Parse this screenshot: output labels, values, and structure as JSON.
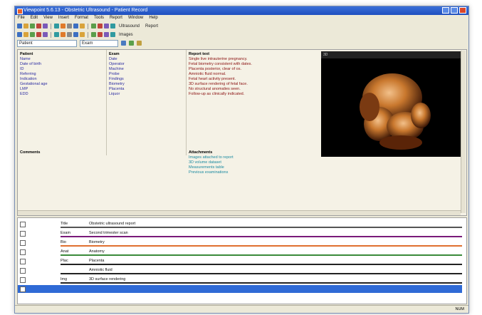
{
  "window": {
    "title": "Viewpoint 5.6.13 - Obstetric Ultrasound - Patient Record",
    "icons": {
      "app": "app-icon",
      "minimize": "minimize-icon",
      "maximize": "maximize-icon",
      "close": "close-icon"
    }
  },
  "menubar": [
    "File",
    "Edit",
    "View",
    "Insert",
    "Format",
    "Tools",
    "Report",
    "Window",
    "Help"
  ],
  "toolbar": {
    "icons1": [
      "new-icon",
      "open-icon",
      "save-icon",
      "print-icon",
      "cut-icon",
      "copy-icon",
      "paste-icon",
      "undo-icon",
      "redo-icon",
      "find-icon",
      "image-icon",
      "report-icon",
      "send-icon",
      "help-icon"
    ],
    "icons2": [
      "patient-icon",
      "exam-icon",
      "measure-icon",
      "calc-icon",
      "graph-icon",
      "chart-icon",
      "settings-icon",
      "lock-icon",
      "mail-icon",
      "user-icon",
      "star-icon",
      "calendar-icon",
      "search-icon",
      "close-icon"
    ],
    "label1": "Ultrasound",
    "label2": "Report",
    "label3": "Images"
  },
  "addressbar": {
    "field1": "Patient",
    "field2": "Exam"
  },
  "details": {
    "col1_heading": "Patient",
    "col1_lines": [
      "Name",
      "Date of birth",
      "ID",
      "Referring",
      "Indication",
      "Gestational age",
      "LMP",
      "EDD"
    ],
    "col2_heading": "Exam",
    "col2_lines": [
      "Date",
      "Operator",
      "Machine",
      "Probe",
      "Findings",
      "Biometry",
      "Placenta",
      "Liquor"
    ],
    "col3_heading": "Report text",
    "col3_lines": [
      "Single live intrauterine pregnancy.",
      "Fetal biometry consistent with dates.",
      "Placenta posterior, clear of os.",
      "Amniotic fluid normal.",
      "Fetal heart activity present.",
      "3D surface rendering of fetal face.",
      "No structural anomalies seen.",
      "Follow-up as clinically indicated."
    ]
  },
  "image": {
    "label": "3D"
  },
  "notes": {
    "heading": "Comments",
    "text": ""
  },
  "links": {
    "heading": "Attachments",
    "items": [
      "Images attached to report",
      "3D volume dataset",
      "Measurements table",
      "Previous examinations"
    ]
  },
  "list": {
    "rows": [
      {
        "c1": "",
        "c2": "Title",
        "c3": "Obstetric ultrasound report",
        "color": "#555555"
      },
      {
        "c1": "",
        "c2": "Exam",
        "c3": "Second trimester scan",
        "color": "#7a1a7a"
      },
      {
        "c1": "",
        "c2": "Bio",
        "c3": "Biometry",
        "color": "#e07030"
      },
      {
        "c1": "",
        "c2": "Anat",
        "c3": "Anatomy",
        "color": "#3a8a3a"
      },
      {
        "c1": "",
        "c2": "Plac",
        "c3": "Placenta",
        "color": "#222222"
      },
      {
        "c1": "",
        "c2": "",
        "c3": "Amniotic fluid",
        "color": "#222222"
      },
      {
        "c1": "",
        "c2": "Img",
        "c3": "3D surface rendering",
        "color": "#222222"
      },
      {
        "c1": "",
        "c2": "",
        "c3": "",
        "color": "#2f6ad6"
      }
    ]
  },
  "status": {
    "right": "NUM"
  }
}
